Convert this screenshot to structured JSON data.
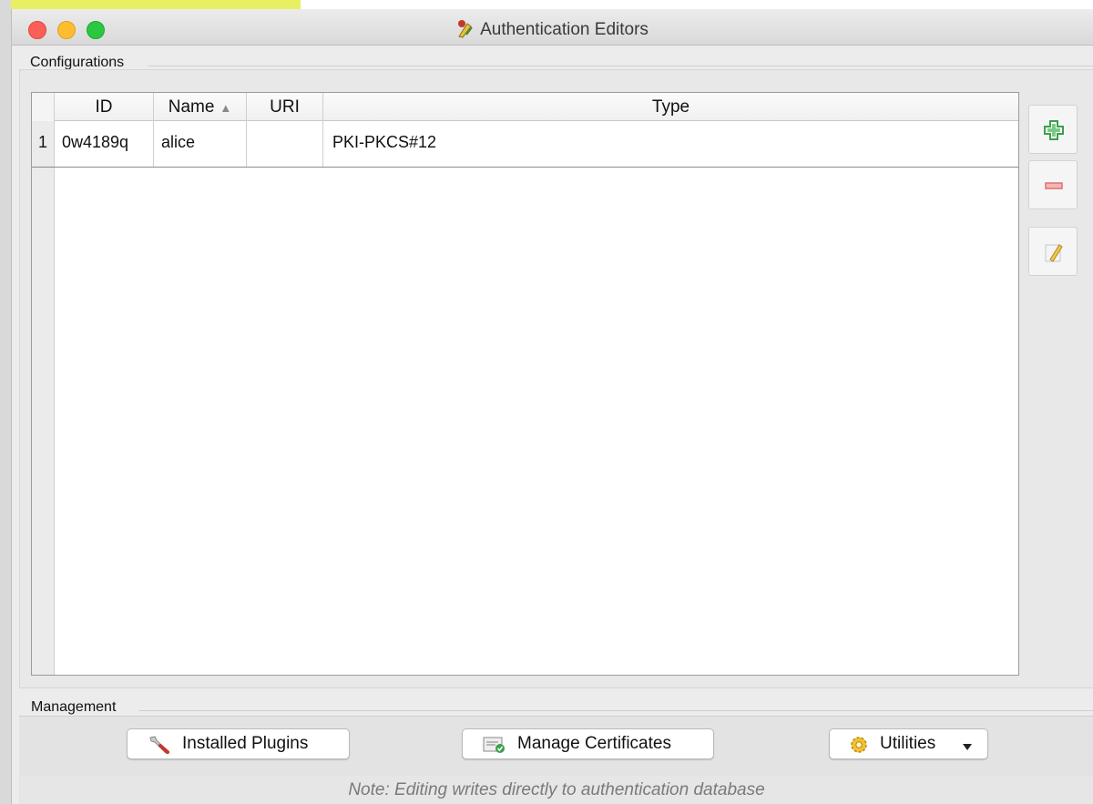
{
  "window": {
    "title": "Authentication Editors"
  },
  "configurations": {
    "group_label": "Configurations",
    "columns": [
      {
        "label": "ID"
      },
      {
        "label": "Name",
        "sort_indicator": "▲"
      },
      {
        "label": "URI"
      },
      {
        "label": "Type"
      }
    ],
    "rows": [
      {
        "num": "1",
        "id": "0w4189q",
        "name": "alice",
        "uri": "",
        "type": "PKI-PKCS#12"
      }
    ]
  },
  "side_buttons": [
    {
      "name": "add-config-button",
      "icon": "plus-icon"
    },
    {
      "name": "remove-config-button",
      "icon": "minus-icon"
    },
    {
      "name": "edit-config-button",
      "icon": "pencil-icon"
    }
  ],
  "management": {
    "group_label": "Management",
    "installed_plugins_label": "Installed Plugins",
    "manage_certificates_label": "Manage Certificates",
    "utilities_label": "Utilities"
  },
  "note": "Note: Editing writes directly to authentication database",
  "colors": {
    "close": "#fc5f57",
    "minimize": "#fdbd2e",
    "maximize": "#2ac840",
    "add": "#3aa04a",
    "remove": "#e07070"
  }
}
